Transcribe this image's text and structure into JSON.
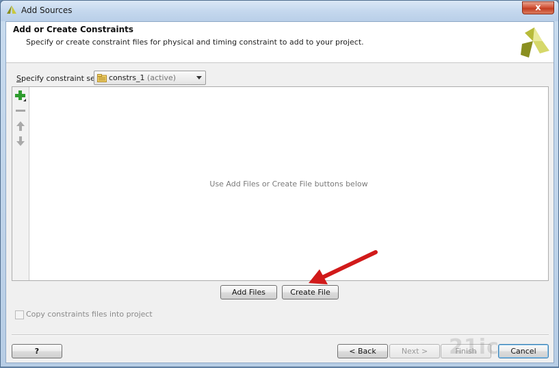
{
  "window": {
    "title": "Add Sources",
    "close_glyph": "x"
  },
  "header": {
    "title": "Add or Create Constraints",
    "subtitle": "Specify or create constraint files for physical and timing constraint to add to your project."
  },
  "constraint_set": {
    "label": "Specify constraint set:",
    "value": "constrs_1",
    "status": "(active)"
  },
  "toolbar": {
    "icons": [
      "add-icon",
      "remove-icon",
      "move-up-icon",
      "move-down-icon"
    ]
  },
  "files": {
    "empty_message": "Use Add Files or Create File buttons below"
  },
  "actions": {
    "add_files": "Add Files",
    "create_file": "Create File"
  },
  "copy_option": {
    "label": "Copy constraints files into project",
    "checked": false
  },
  "footer": {
    "help": "?",
    "back": "< Back",
    "next": "Next >",
    "finish": "Finish",
    "cancel": "Cancel"
  },
  "watermark": "21ic",
  "colors": {
    "arrow": "#d11a1a",
    "add_icon": "#2e9c2e",
    "logo_light": "#e9ea9a",
    "logo_dark": "#8a8f20"
  }
}
